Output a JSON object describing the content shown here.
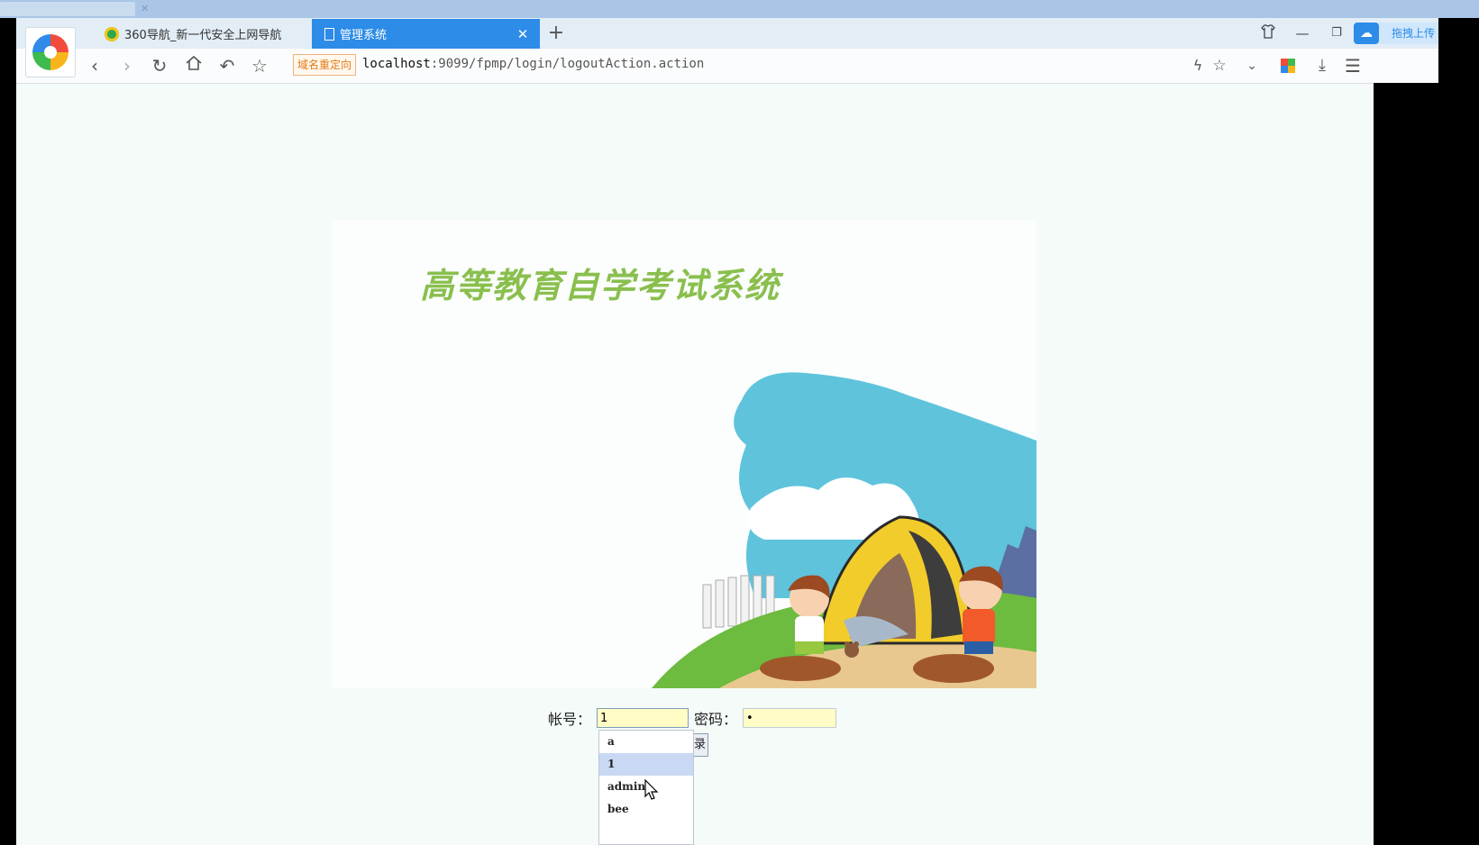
{
  "browser": {
    "tabs": [
      {
        "label": "360导航_新一代安全上网导航",
        "close": "✕"
      },
      {
        "label": "管理系统",
        "close": "✕"
      }
    ],
    "new_tab": "+",
    "cloud_label": "拖拽上传",
    "redirect_badge": "域名重定向",
    "url_host": "localhost",
    "url_rest": ":9099/fpmp/login/logoutAction.action"
  },
  "page": {
    "site_title": "高等教育自学考试系统",
    "account_label": "帐号：",
    "account_value": "1",
    "password_label": "密码：",
    "password_value": "•",
    "login_button_partial": "录",
    "autocomplete": [
      "a",
      "1",
      "admin",
      "bee"
    ],
    "autocomplete_selected": "1"
  },
  "colors": {
    "accent": "#2d8ce8",
    "title_green": "#8abf4e",
    "page_bg": "#f4fbf8",
    "input_bg": "#fffdc5"
  }
}
